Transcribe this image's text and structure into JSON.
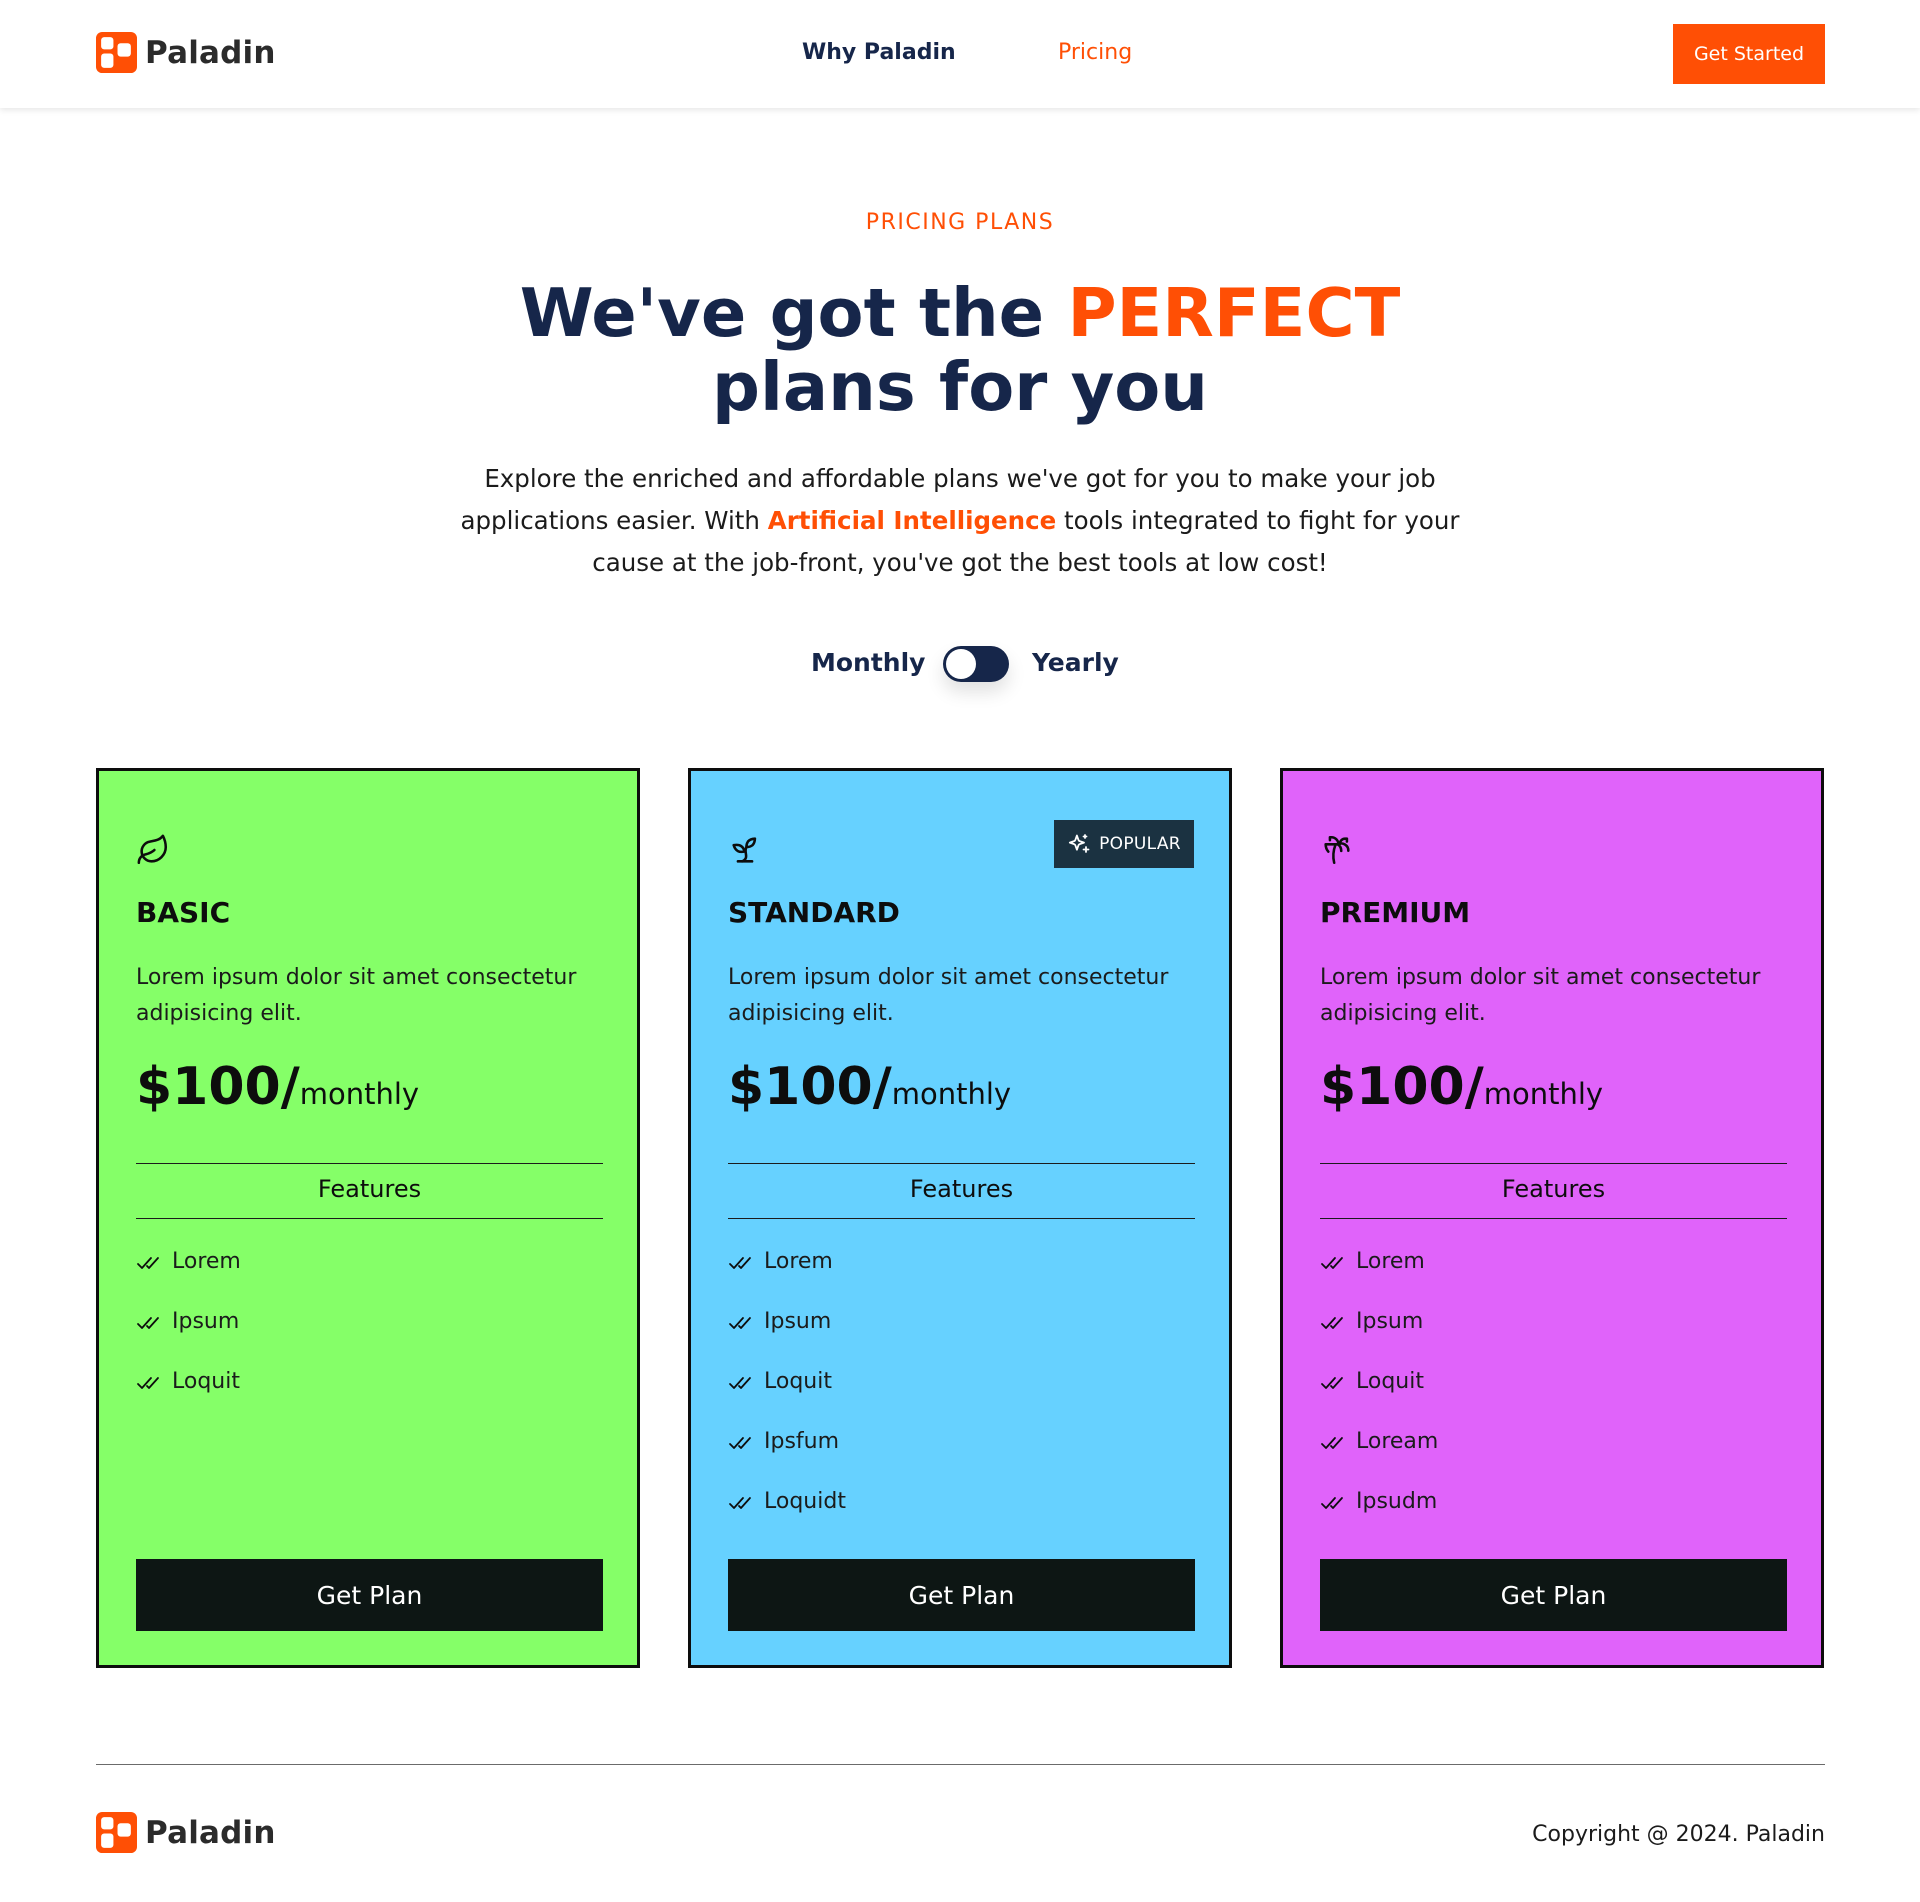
{
  "brand": {
    "name": "Paladin",
    "accent": "#ff4f05",
    "navy": "#16264a"
  },
  "nav": {
    "items": [
      {
        "label": "Why Paladin",
        "active": false
      },
      {
        "label": "Pricing",
        "active": true
      }
    ],
    "cta_label": "Get Started"
  },
  "hero": {
    "eyebrow": "PRICING PLANS",
    "title_part1": "We've got the ",
    "title_accent": "PERFECT",
    "title_part2": "plans for you",
    "desc_part1": "Explore the enriched and affordable plans we've got for you to make your job applications easier. With ",
    "desc_accent": "Artificial Intelligence",
    "desc_part2": " tools integrated to fight for your cause at the job-front, you've got the best tools at low cost!"
  },
  "billing_toggle": {
    "left_label": "Monthly",
    "right_label": "Yearly",
    "selected": "Monthly"
  },
  "plans": [
    {
      "name": "BASIC",
      "icon": "leaf-icon",
      "color": "#85ff68",
      "description": "Lorem ipsum dolor sit amet consectetur adipisicing elit.",
      "price": "$100/",
      "period": "monthly",
      "features_label": "Features",
      "features": [
        "Lorem",
        "Ipsum",
        "Loquit"
      ],
      "button_label": "Get Plan"
    },
    {
      "name": "STANDARD",
      "icon": "sprout-icon",
      "color": "#66d1ff",
      "badge": "POPULAR",
      "badge_icon": "sparkles-icon",
      "description": "Lorem ipsum dolor sit amet consectetur adipisicing elit.",
      "price": "$100/",
      "period": "monthly",
      "features_label": "Features",
      "features": [
        "Lorem",
        "Ipsum",
        "Loquit",
        "Ipsfum",
        "Loquidt"
      ],
      "button_label": "Get Plan"
    },
    {
      "name": "PREMIUM",
      "icon": "palm-tree-icon",
      "color": "#e063fa",
      "description": "Lorem ipsum dolor sit amet consectetur adipisicing elit.",
      "price": "$100/",
      "period": "monthly",
      "features_label": "Features",
      "features": [
        "Lorem",
        "Ipsum",
        "Loquit",
        "Loream",
        "Ipsudm"
      ],
      "button_label": "Get Plan"
    }
  ],
  "footer": {
    "brand": "Paladin",
    "copyright": "Copyright @ 2024. Paladin"
  }
}
